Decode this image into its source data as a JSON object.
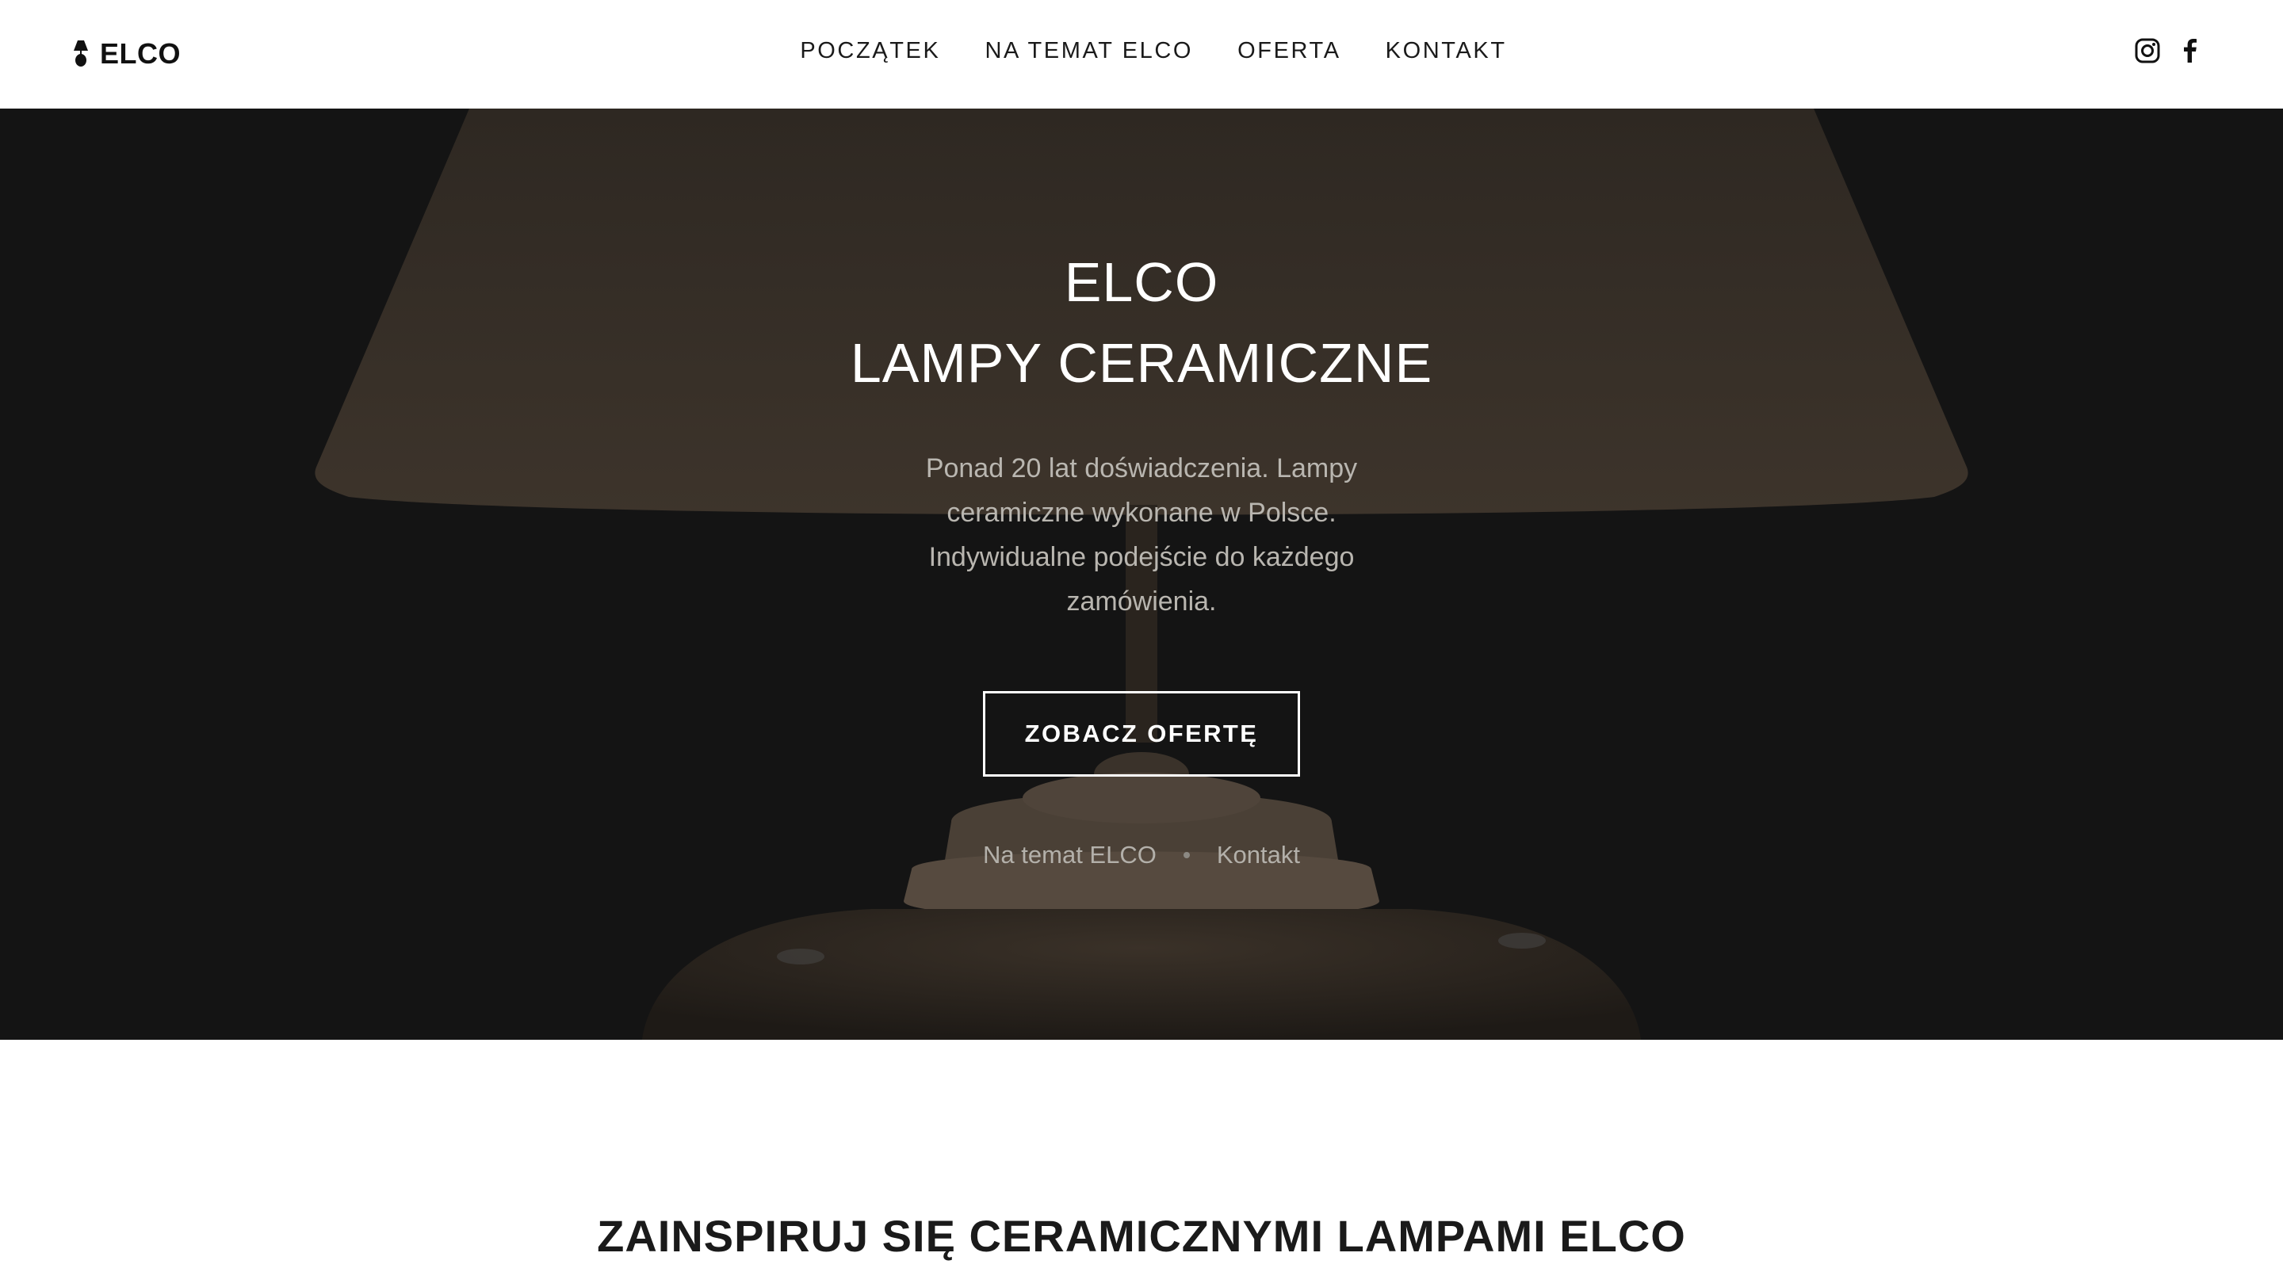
{
  "brand": {
    "name": "ELCO",
    "icon": "lamp-icon"
  },
  "nav": {
    "items": [
      {
        "label": "POCZĄTEK"
      },
      {
        "label": "NA TEMAT ELCO"
      },
      {
        "label": "OFERTA"
      },
      {
        "label": "KONTAKT"
      }
    ]
  },
  "social": {
    "items": [
      {
        "icon": "instagram-icon"
      },
      {
        "icon": "facebook-icon"
      }
    ]
  },
  "hero": {
    "title_line1": "ELCO",
    "title_line2": "LAMPY CERAMICZNE",
    "description": "Ponad 20 lat doświadczenia. Lampy ceramiczne wykonane w Polsce. Indywidualne podejście do każdego zamówienia.",
    "cta_label": "ZOBACZ OFERTĘ",
    "links": [
      {
        "label": "Na temat ELCO"
      },
      {
        "label": "Kontakt"
      }
    ]
  },
  "section": {
    "heading": "ZAINSPIRUJ SIĘ CERAMICZNYMI LAMPAMI ELCO"
  },
  "colors": {
    "header_bg": "#ffffff",
    "hero_bg": "#141414",
    "hero_text": "#ffffff",
    "hero_muted": "#b9b6b0",
    "body_text": "#1a1a1a"
  }
}
